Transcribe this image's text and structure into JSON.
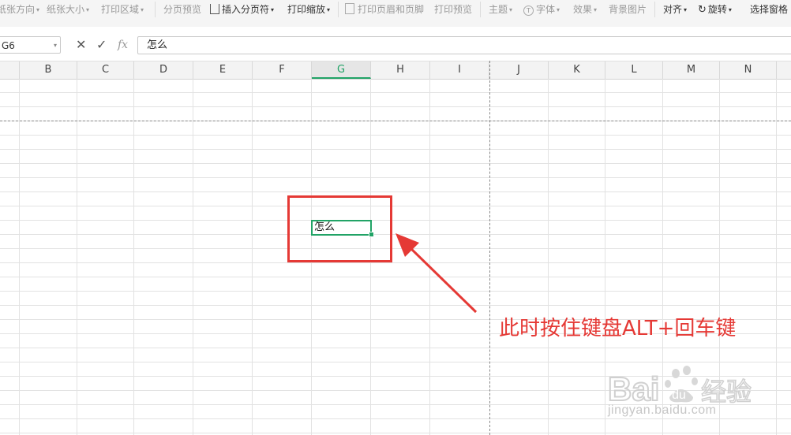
{
  "toolbar": {
    "items": [
      {
        "label": "纸张方向",
        "dropdown": true
      },
      {
        "label": "纸张大小",
        "dropdown": true
      },
      {
        "label": "打印区域",
        "dropdown": true
      },
      {
        "label": "分页预览",
        "dropdown": false
      },
      {
        "label": "插入分页符",
        "dropdown": true
      },
      {
        "label": "打印缩放",
        "dropdown": true
      },
      {
        "label": "打印页眉和页脚",
        "dropdown": false
      },
      {
        "label": "打印预览",
        "dropdown": false
      },
      {
        "label": "主题",
        "dropdown": true
      },
      {
        "label": "字体",
        "dropdown": true
      },
      {
        "label": "效果",
        "dropdown": true
      },
      {
        "label": "背景图片",
        "dropdown": false
      },
      {
        "label": "对齐",
        "dropdown": true
      },
      {
        "label": "旋转",
        "dropdown": true
      },
      {
        "label": "选择窗格",
        "dropdown": false
      }
    ]
  },
  "formula_bar": {
    "name_box": "G6",
    "cancel_icon": "cross-icon",
    "confirm_icon": "check-icon",
    "fx_label": "fx",
    "value": "怎么"
  },
  "columns": [
    "B",
    "C",
    "D",
    "E",
    "F",
    "G",
    "H",
    "I",
    "J",
    "K",
    "L",
    "M",
    "N"
  ],
  "selected_column": "G",
  "active_cell": {
    "ref": "G6",
    "value": "怎么"
  },
  "annotation": {
    "text": "此时按住键盘ALT+回车键",
    "color": "#e53935"
  },
  "watermark": {
    "brand": "Bai 经验",
    "url": "jingyan.baidu.com"
  },
  "colors": {
    "accent": "#21a366",
    "annotation": "#e53935"
  }
}
